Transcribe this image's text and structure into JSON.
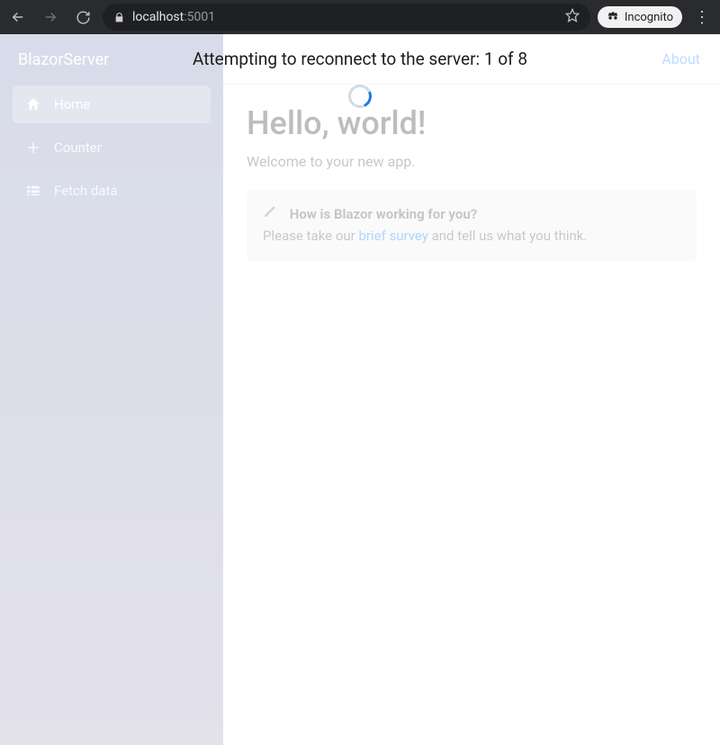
{
  "browser": {
    "url_host": "localhost",
    "url_port": ":5001",
    "incognito_label": "Incognito"
  },
  "overlay": {
    "message": "Attempting to reconnect to the server: 1 of 8"
  },
  "brand": "BlazorServer",
  "sidebar": {
    "items": [
      {
        "label": "Home",
        "icon": "home-icon",
        "active": true
      },
      {
        "label": "Counter",
        "icon": "plus-icon",
        "active": false
      },
      {
        "label": "Fetch data",
        "icon": "list-icon",
        "active": false
      }
    ]
  },
  "header": {
    "about": "About"
  },
  "main": {
    "title": "Hello, world!",
    "welcome": "Welcome to your new app.",
    "callout": {
      "question": "How is Blazor working for you?",
      "prefix": "Please take our ",
      "link": "brief survey",
      "suffix": " and tell us what you think."
    }
  }
}
